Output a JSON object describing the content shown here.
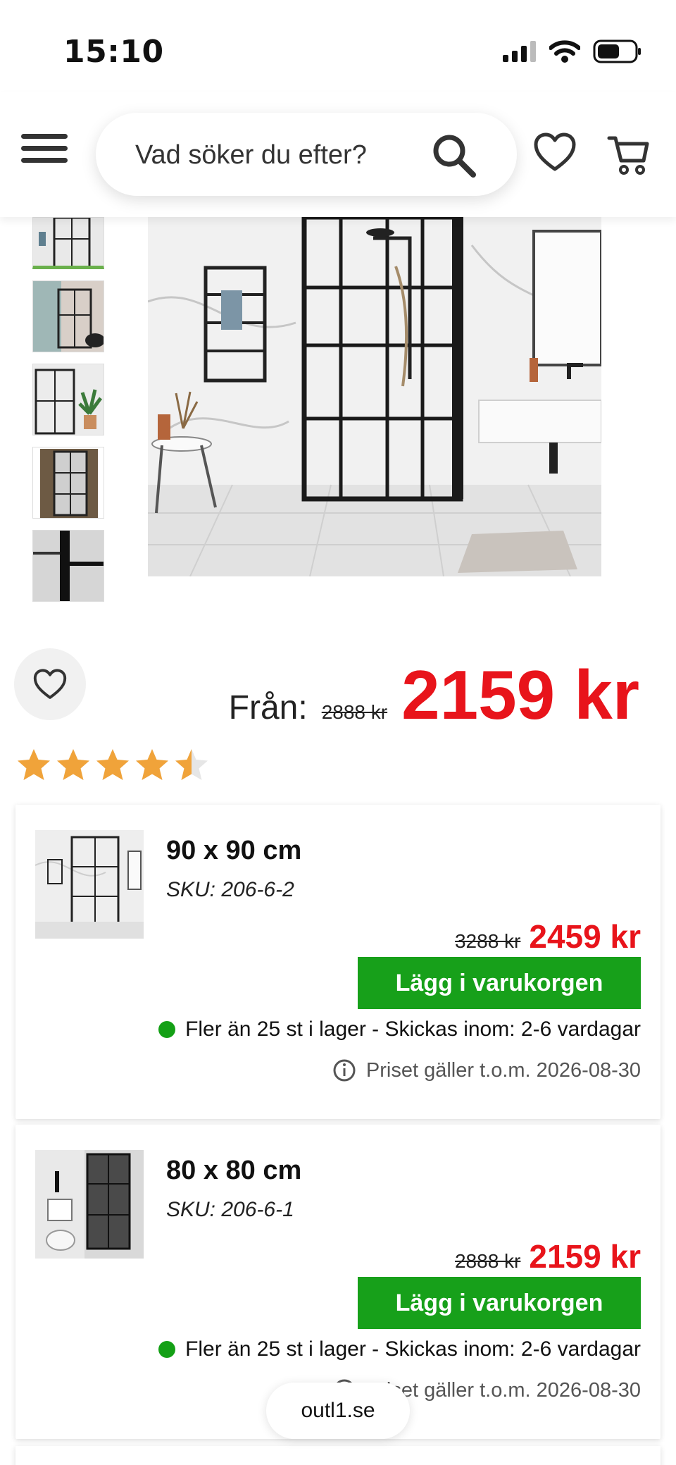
{
  "status_bar": {
    "time": "15:10"
  },
  "header": {
    "search_placeholder": "Vad söker du efter?"
  },
  "product": {
    "from_label": "Från:",
    "old_price": "2888 kr",
    "price": "2159 kr",
    "rating": 4.5,
    "rating_max": 5
  },
  "variants": [
    {
      "title": "90 x 90 cm",
      "sku": "SKU: 206-6-2",
      "old_price": "3288 kr",
      "price": "2459 kr",
      "button_label": "Lägg i varukorgen",
      "stock_text": "Fler än 25 st i lager - Skickas inom: 2-6 vardagar",
      "validity_text": "Priset gäller t.o.m. 2026-08-30"
    },
    {
      "title": "80 x 80 cm",
      "sku": "SKU: 206-6-1",
      "old_price": "2888 kr",
      "price": "2159 kr",
      "button_label": "Lägg i varukorgen",
      "stock_text": "Fler än 25 st i lager - Skickas inom: 2-6 vardagar",
      "validity_text": "Priset gäller t.o.m. 2026-08-30"
    }
  ],
  "browser": {
    "url": "outl1.se"
  },
  "colors": {
    "price_red": "#e8141b",
    "button_green": "#17a01a",
    "stock_green": "#14a016",
    "star_orange": "#f0a33a"
  },
  "icons": [
    "menu-icon",
    "search-icon",
    "heart-icon",
    "cart-icon",
    "info-icon",
    "star-icon",
    "signal-icon",
    "wifi-icon",
    "battery-icon"
  ]
}
